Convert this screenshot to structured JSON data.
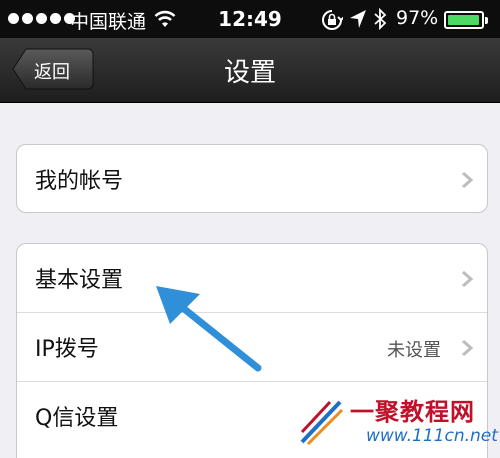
{
  "status_bar": {
    "carrier": "中国联通",
    "time": "12:49",
    "battery_percent": "97%",
    "battery_level": 0.97,
    "icons": [
      "signal-dots-icon",
      "wifi-icon",
      "rotation-lock-icon",
      "location-arrow-icon",
      "bluetooth-icon",
      "battery-icon"
    ]
  },
  "nav": {
    "back_label": "返回",
    "title": "设置"
  },
  "group1": {
    "rows": [
      {
        "label": "我的帐号",
        "value": ""
      }
    ]
  },
  "group2": {
    "rows": [
      {
        "label": "基本设置",
        "value": ""
      },
      {
        "label": "IP拨号",
        "value": "未设置"
      },
      {
        "label": "Q信设置",
        "value": ""
      }
    ]
  },
  "watermark": {
    "brand": "一聚教程网",
    "url": "www.111cn.net"
  },
  "colors": {
    "accent_arrow": "#2f8fd8",
    "battery": "#4cd964",
    "brand_red": "#c0102a"
  }
}
